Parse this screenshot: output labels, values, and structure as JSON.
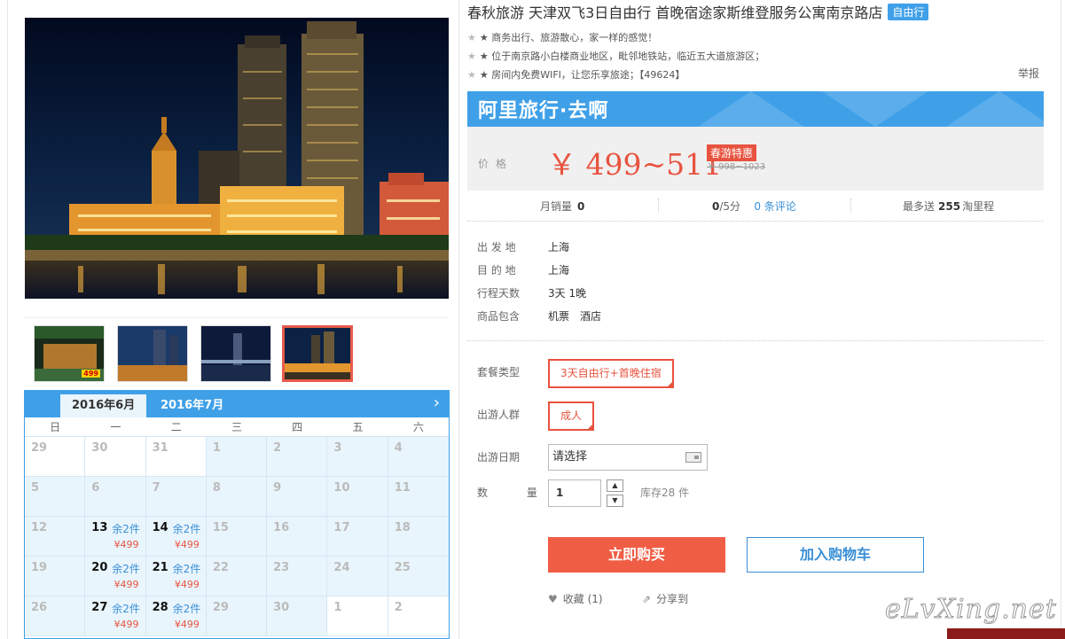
{
  "product": {
    "title": "春秋旅游 天津双飞3日自由行 首晚宿途家斯维登服务公寓南京路店",
    "tag": "自由行",
    "features": [
      "★ 商务出行、旅游散心，家一样的感觉！",
      "★ 位于南京路小白楼商业地区，毗邻地铁站，临近五大道旅游区；",
      "★ 房间内免费WIFI，让您乐享旅途；【49624】"
    ],
    "report_label": "举报"
  },
  "price": {
    "brand": "阿里旅行·去啊",
    "label": "价格",
    "value": "￥ 499~511",
    "promo_tag": "春游特惠",
    "original": "￥ 998~1023"
  },
  "stats": {
    "monthly_sales_label": "月销量",
    "monthly_sales": "0",
    "rating": "0",
    "rating_suffix": "/5分",
    "reviews": "0 条评论",
    "miles_label": "最多送",
    "miles": "255",
    "miles_unit": "淘里程"
  },
  "info": {
    "depart_label": "出 发 地",
    "depart": "上海",
    "dest_label": "目 的 地",
    "dest": "上海",
    "days_label": "行程天数",
    "days": "3天 1晚",
    "includes_label": "商品包含",
    "includes": [
      "机票",
      "酒店"
    ]
  },
  "options": {
    "package_label": "套餐类型",
    "package": "3天自由行+首晚住宿",
    "crowd_label": "出游人群",
    "crowd": "成人",
    "date_label": "出游日期",
    "date_placeholder": "请选择",
    "qty_label": "数 量",
    "qty": "1",
    "stock": "库存28 件"
  },
  "actions": {
    "buy": "立即购买",
    "cart": "加入购物车",
    "favorite": "收藏 (1)",
    "share": "分享到"
  },
  "calendar": {
    "tabs": [
      "2016年6月",
      "2016年7月"
    ],
    "weekdays": [
      "日",
      "一",
      "二",
      "三",
      "四",
      "五",
      "六"
    ],
    "cells": [
      {
        "d": "29",
        "type": "other"
      },
      {
        "d": "30",
        "type": "other"
      },
      {
        "d": "31",
        "type": "other"
      },
      {
        "d": "1"
      },
      {
        "d": "2"
      },
      {
        "d": "3"
      },
      {
        "d": "4"
      },
      {
        "d": "5"
      },
      {
        "d": "6"
      },
      {
        "d": "7"
      },
      {
        "d": "8"
      },
      {
        "d": "9"
      },
      {
        "d": "10"
      },
      {
        "d": "11"
      },
      {
        "d": "12"
      },
      {
        "d": "13",
        "type": "avail",
        "stock": "余2件",
        "price": "¥499"
      },
      {
        "d": "14",
        "type": "avail",
        "stock": "余2件",
        "price": "¥499"
      },
      {
        "d": "15"
      },
      {
        "d": "16"
      },
      {
        "d": "17"
      },
      {
        "d": "18"
      },
      {
        "d": "19"
      },
      {
        "d": "20",
        "type": "avail",
        "stock": "余2件",
        "price": "¥499"
      },
      {
        "d": "21",
        "type": "avail",
        "stock": "余2件",
        "price": "¥499"
      },
      {
        "d": "22"
      },
      {
        "d": "23"
      },
      {
        "d": "24"
      },
      {
        "d": "25"
      },
      {
        "d": "26"
      },
      {
        "d": "27",
        "type": "avail",
        "stock": "余2件",
        "price": "¥499"
      },
      {
        "d": "28",
        "type": "avail",
        "stock": "余2件",
        "price": "¥499"
      },
      {
        "d": "29"
      },
      {
        "d": "30"
      },
      {
        "d": "1",
        "type": "other"
      },
      {
        "d": "2",
        "type": "other"
      }
    ]
  },
  "thumb_badge": "499",
  "watermark": "eLvXing.net",
  "colors": {
    "accent_blue": "#3fa0e8",
    "price_red": "#e8533f",
    "buy_red": "#f05d45"
  }
}
